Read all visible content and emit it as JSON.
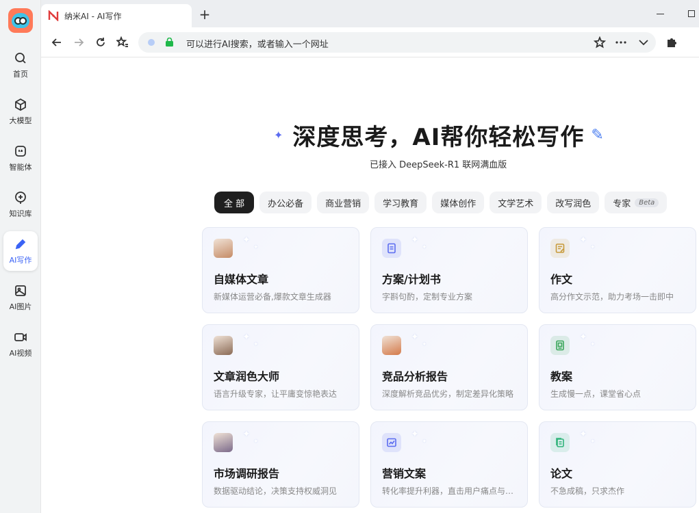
{
  "sidebar": {
    "items": [
      {
        "label": "首页",
        "icon": "search-icon"
      },
      {
        "label": "大模型",
        "icon": "cube-icon"
      },
      {
        "label": "智能体",
        "icon": "agent-icon"
      },
      {
        "label": "知识库",
        "icon": "knowledge-icon"
      },
      {
        "label": "AI写作",
        "icon": "pen-icon",
        "active": true
      },
      {
        "label": "AI图片",
        "icon": "image-icon"
      },
      {
        "label": "AI视频",
        "icon": "video-icon"
      }
    ]
  },
  "browser": {
    "tab_title": "纳米AI - AI写作",
    "new_tab": "+",
    "address_placeholder": "可以进行AI搜索，或者输入一个网址"
  },
  "hero": {
    "title": "深度思考，AI帮你轻松写作",
    "subtitle": "已接入 DeepSeek-R1 联网满血版"
  },
  "categories": [
    {
      "label": "全 部",
      "active": true
    },
    {
      "label": "办公必备"
    },
    {
      "label": "商业营销"
    },
    {
      "label": "学习教育"
    },
    {
      "label": "媒体创作"
    },
    {
      "label": "文学艺术"
    },
    {
      "label": "改写润色"
    },
    {
      "label": "专家",
      "badge": "Beta"
    }
  ],
  "cards": [
    {
      "title": "自媒体文章",
      "desc": "新媒体运营必备,爆款文章生成器",
      "icon": "writer-avatar-icon",
      "color": "#c58b66"
    },
    {
      "title": "方案/计划书",
      "desc": "字斟句酌，定制专业方案",
      "icon": "document-icon",
      "color": "#5b6cf0"
    },
    {
      "title": "作文",
      "desc": "高分作文示范，助力考场一击即中",
      "icon": "notepad-icon",
      "color": "#c79a3a"
    },
    {
      "title": "文章润色大师",
      "desc": "语言升级专家，让平庸变惊艳表达",
      "icon": "editor-avatar-icon",
      "color": "#8a6a55"
    },
    {
      "title": "竞品分析报告",
      "desc": "深度解析竞品优劣，制定差异化策略",
      "icon": "analyst-avatar-icon",
      "color": "#d47a4a"
    },
    {
      "title": "教案",
      "desc": "生成慢一点，课堂省心点",
      "icon": "lesson-book-icon",
      "color": "#3aa65a"
    },
    {
      "title": "市场调研报告",
      "desc": "数据驱动结论，决策支持权威洞见",
      "icon": "research-avatar-icon",
      "color": "#7b6a8a"
    },
    {
      "title": "营销文案",
      "desc": "转化率提升利器，直击用户痛点与需求",
      "icon": "chart-icon",
      "color": "#5b6cf0"
    },
    {
      "title": "论文",
      "desc": "不急成稿，只求杰作",
      "icon": "paper-icon",
      "color": "#2fb37a"
    }
  ]
}
